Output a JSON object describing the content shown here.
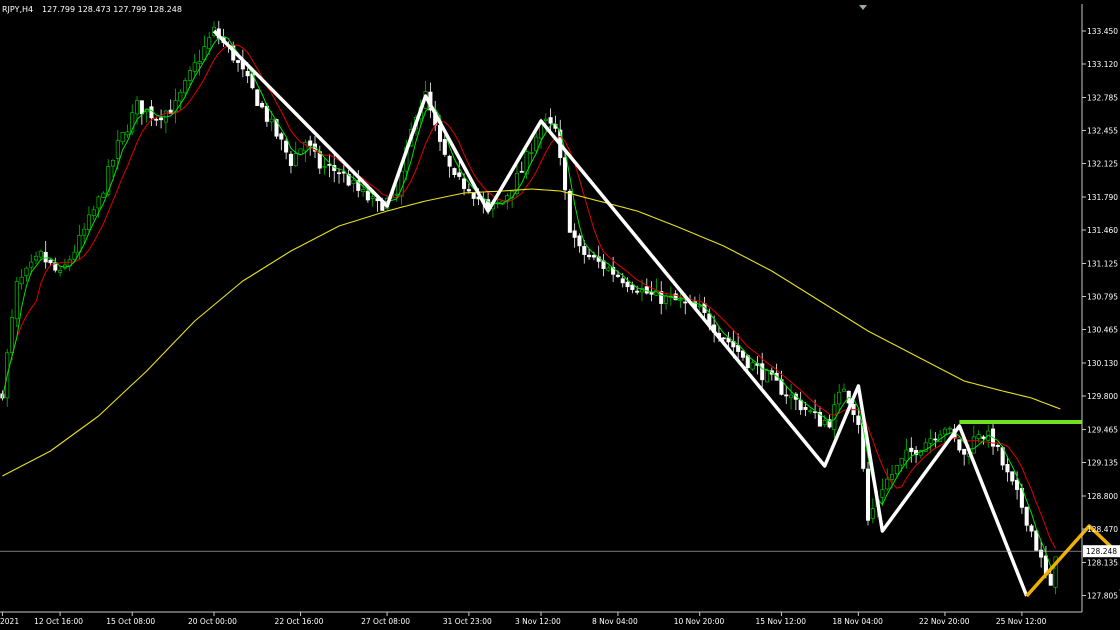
{
  "header": {
    "symbol": "RJPY,H4",
    "ohlc": "127.799 128.473 127.799 128.248"
  },
  "colors": {
    "background": "#000000",
    "frame": "#c8c8c8",
    "bull_candle": "#00c000",
    "bear_candle": "#ffffff",
    "fast_ma": "#00e000",
    "mid_ma": "#e00000",
    "slow_ma": "#e8e020",
    "zigzag": "#ffffff",
    "resistance": "#70e020",
    "projection": "#f0b000",
    "price_label_bg": "#ffffff"
  },
  "chart_data": {
    "type": "line",
    "title": "",
    "xlabel": "",
    "ylabel": "",
    "ylim": [
      127.64,
      133.72
    ],
    "y_ticks": [
      "133.450",
      "133.120",
      "132.785",
      "132.455",
      "132.125",
      "131.790",
      "131.460",
      "131.125",
      "130.795",
      "130.465",
      "130.130",
      "129.800",
      "129.465",
      "129.135",
      "128.800",
      "128.470",
      "128.135",
      "127.805"
    ],
    "x_ticks": [
      "2021",
      "12 Oct 16:00",
      "15 Oct 08:00",
      "20 Oct 00:00",
      "22 Oct 16:00",
      "27 Oct 08:00",
      "31 Oct 23:00",
      "3 Nov 12:00",
      "8 Nov 04:00",
      "10 Nov 20:00",
      "15 Nov 12:00",
      "18 Nov 04:00",
      "22 Nov 20:00",
      "25 Nov 12:00"
    ],
    "x_tick_index": [
      0,
      12,
      27,
      44,
      62,
      80,
      97,
      112,
      128,
      145,
      162,
      178,
      196,
      212
    ],
    "bar_count": 225,
    "current_price": "128.248",
    "price_anchors": [
      [
        0,
        129.85
      ],
      [
        3,
        130.9
      ],
      [
        8,
        131.2
      ],
      [
        12,
        131.0
      ],
      [
        16,
        131.35
      ],
      [
        20,
        131.75
      ],
      [
        24,
        132.3
      ],
      [
        28,
        132.7
      ],
      [
        32,
        132.6
      ],
      [
        36,
        132.7
      ],
      [
        40,
        133.1
      ],
      [
        44,
        133.45
      ],
      [
        48,
        133.2
      ],
      [
        52,
        132.85
      ],
      [
        56,
        132.5
      ],
      [
        60,
        132.15
      ],
      [
        63,
        132.35
      ],
      [
        66,
        132.1
      ],
      [
        70,
        132.05
      ],
      [
        74,
        131.85
      ],
      [
        78,
        131.7
      ],
      [
        82,
        131.8
      ],
      [
        86,
        132.65
      ],
      [
        88,
        132.8
      ],
      [
        91,
        132.3
      ],
      [
        94,
        131.95
      ],
      [
        97,
        131.9
      ],
      [
        101,
        131.65
      ],
      [
        104,
        131.75
      ],
      [
        108,
        132.05
      ],
      [
        112,
        132.55
      ],
      [
        115,
        132.45
      ],
      [
        118,
        131.5
      ],
      [
        120,
        131.25
      ],
      [
        125,
        131.1
      ],
      [
        130,
        130.95
      ],
      [
        135,
        130.8
      ],
      [
        140,
        130.75
      ],
      [
        145,
        130.65
      ],
      [
        150,
        130.4
      ],
      [
        155,
        130.15
      ],
      [
        160,
        129.95
      ],
      [
        165,
        129.75
      ],
      [
        170,
        129.55
      ],
      [
        172,
        129.55
      ],
      [
        175,
        129.9
      ],
      [
        178,
        129.55
      ],
      [
        180,
        128.55
      ],
      [
        183,
        128.9
      ],
      [
        188,
        129.2
      ],
      [
        192,
        129.35
      ],
      [
        196,
        129.5
      ],
      [
        200,
        129.2
      ],
      [
        203,
        129.45
      ],
      [
        206,
        129.35
      ],
      [
        209,
        129.0
      ],
      [
        212,
        128.7
      ],
      [
        214,
        128.45
      ],
      [
        216,
        128.15
      ],
      [
        218,
        127.85
      ],
      [
        219,
        128.25
      ]
    ],
    "slow_ma_anchors": [
      [
        0,
        129.0
      ],
      [
        10,
        129.25
      ],
      [
        20,
        129.6
      ],
      [
        30,
        130.05
      ],
      [
        40,
        130.55
      ],
      [
        50,
        130.95
      ],
      [
        60,
        131.25
      ],
      [
        70,
        131.5
      ],
      [
        80,
        131.65
      ],
      [
        88,
        131.75
      ],
      [
        96,
        131.83
      ],
      [
        104,
        131.85
      ],
      [
        110,
        131.87
      ],
      [
        116,
        131.85
      ],
      [
        124,
        131.75
      ],
      [
        132,
        131.65
      ],
      [
        140,
        131.5
      ],
      [
        150,
        131.3
      ],
      [
        160,
        131.05
      ],
      [
        170,
        130.75
      ],
      [
        180,
        130.45
      ],
      [
        190,
        130.2
      ],
      [
        200,
        129.95
      ],
      [
        208,
        129.85
      ],
      [
        214,
        129.78
      ],
      [
        220,
        129.67
      ]
    ],
    "series": [
      {
        "name": "",
        "type": "zigzag",
        "points": [
          [
            44,
            133.45
          ],
          [
            80,
            131.7
          ],
          [
            88,
            132.8
          ],
          [
            101,
            131.65
          ],
          [
            112,
            132.55
          ],
          [
            171,
            129.1
          ],
          [
            178,
            129.9
          ],
          [
            183,
            128.45
          ],
          [
            199,
            129.5
          ],
          [
            213,
            127.8
          ]
        ]
      },
      {
        "name": "",
        "type": "projection",
        "points": [
          [
            213,
            127.8
          ],
          [
            226,
            128.5
          ],
          [
            238,
            127.95
          ]
        ]
      },
      {
        "name": "",
        "type": "horizontal_level",
        "value": 129.54,
        "from_index": 199
      }
    ]
  }
}
